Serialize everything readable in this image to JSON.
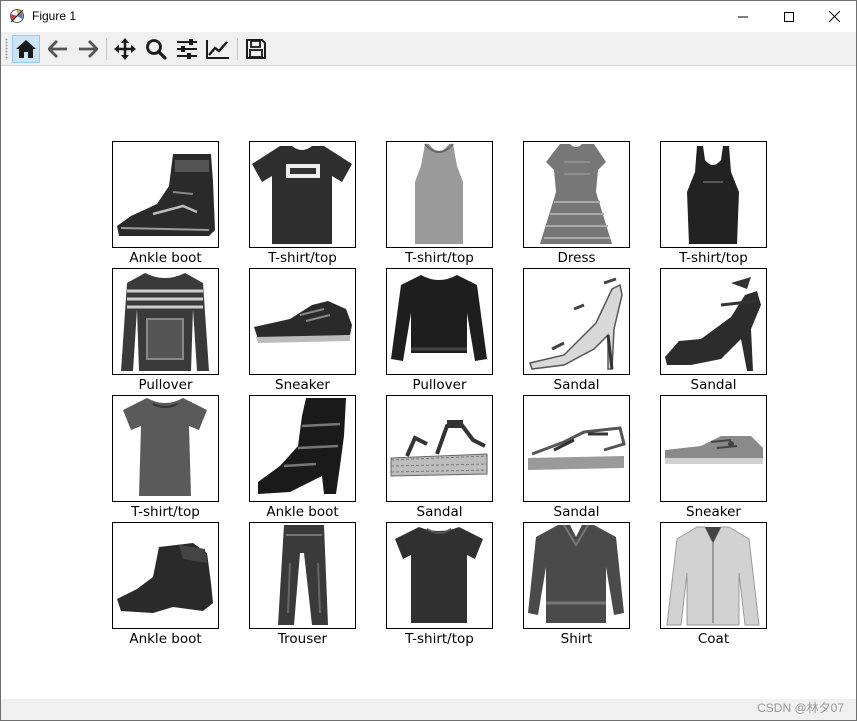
{
  "window": {
    "title": "Figure 1"
  },
  "toolbar": {
    "buttons": [
      {
        "name": "home-button",
        "icon": "home-icon",
        "active": true
      },
      {
        "name": "back-button",
        "icon": "arrow-left-icon",
        "active": false
      },
      {
        "name": "forward-button",
        "icon": "arrow-right-icon",
        "active": false
      },
      {
        "name": "pan-button",
        "icon": "move-arrows-icon",
        "active": false
      },
      {
        "name": "zoom-button",
        "icon": "magnifier-icon",
        "active": false
      },
      {
        "name": "configure-subplots-button",
        "icon": "sliders-icon",
        "active": false
      },
      {
        "name": "edit-axes-button",
        "icon": "line-chart-icon",
        "active": false
      },
      {
        "name": "save-button",
        "icon": "floppy-disk-icon",
        "active": false
      }
    ]
  },
  "figure": {
    "grid": {
      "rows": 4,
      "cols": 5
    },
    "items": [
      {
        "label": "Ankle boot",
        "icon": "ankle-boot-image"
      },
      {
        "label": "T-shirt/top",
        "icon": "tshirt-image"
      },
      {
        "label": "T-shirt/top",
        "icon": "tanktop-image"
      },
      {
        "label": "Dress",
        "icon": "dress-image"
      },
      {
        "label": "T-shirt/top",
        "icon": "tanktop-dark-image"
      },
      {
        "label": "Pullover",
        "icon": "pullover-striped-image"
      },
      {
        "label": "Sneaker",
        "icon": "sneaker-image"
      },
      {
        "label": "Pullover",
        "icon": "pullover-image"
      },
      {
        "label": "Sandal",
        "icon": "sandal-heel-image"
      },
      {
        "label": "Sandal",
        "icon": "sandal-heel-dark-image"
      },
      {
        "label": "T-shirt/top",
        "icon": "tshirt-long-image"
      },
      {
        "label": "Ankle boot",
        "icon": "ankle-boot-tall-image"
      },
      {
        "label": "Sandal",
        "icon": "sandal-flat-image"
      },
      {
        "label": "Sandal",
        "icon": "sandal-flat-light-image"
      },
      {
        "label": "Sneaker",
        "icon": "sneaker-low-image"
      },
      {
        "label": "Ankle boot",
        "icon": "ankle-boot-low-image"
      },
      {
        "label": "Trouser",
        "icon": "trouser-image"
      },
      {
        "label": "T-shirt/top",
        "icon": "tshirt-plain-image"
      },
      {
        "label": "Shirt",
        "icon": "shirt-image"
      },
      {
        "label": "Coat",
        "icon": "coat-image"
      }
    ]
  },
  "status": {
    "watermark": "CSDN @林夕07"
  },
  "colors": {
    "toolbar_bg": "#f0f0f0",
    "active_button": "#cce4f7",
    "icon": "#1a1a1a"
  }
}
